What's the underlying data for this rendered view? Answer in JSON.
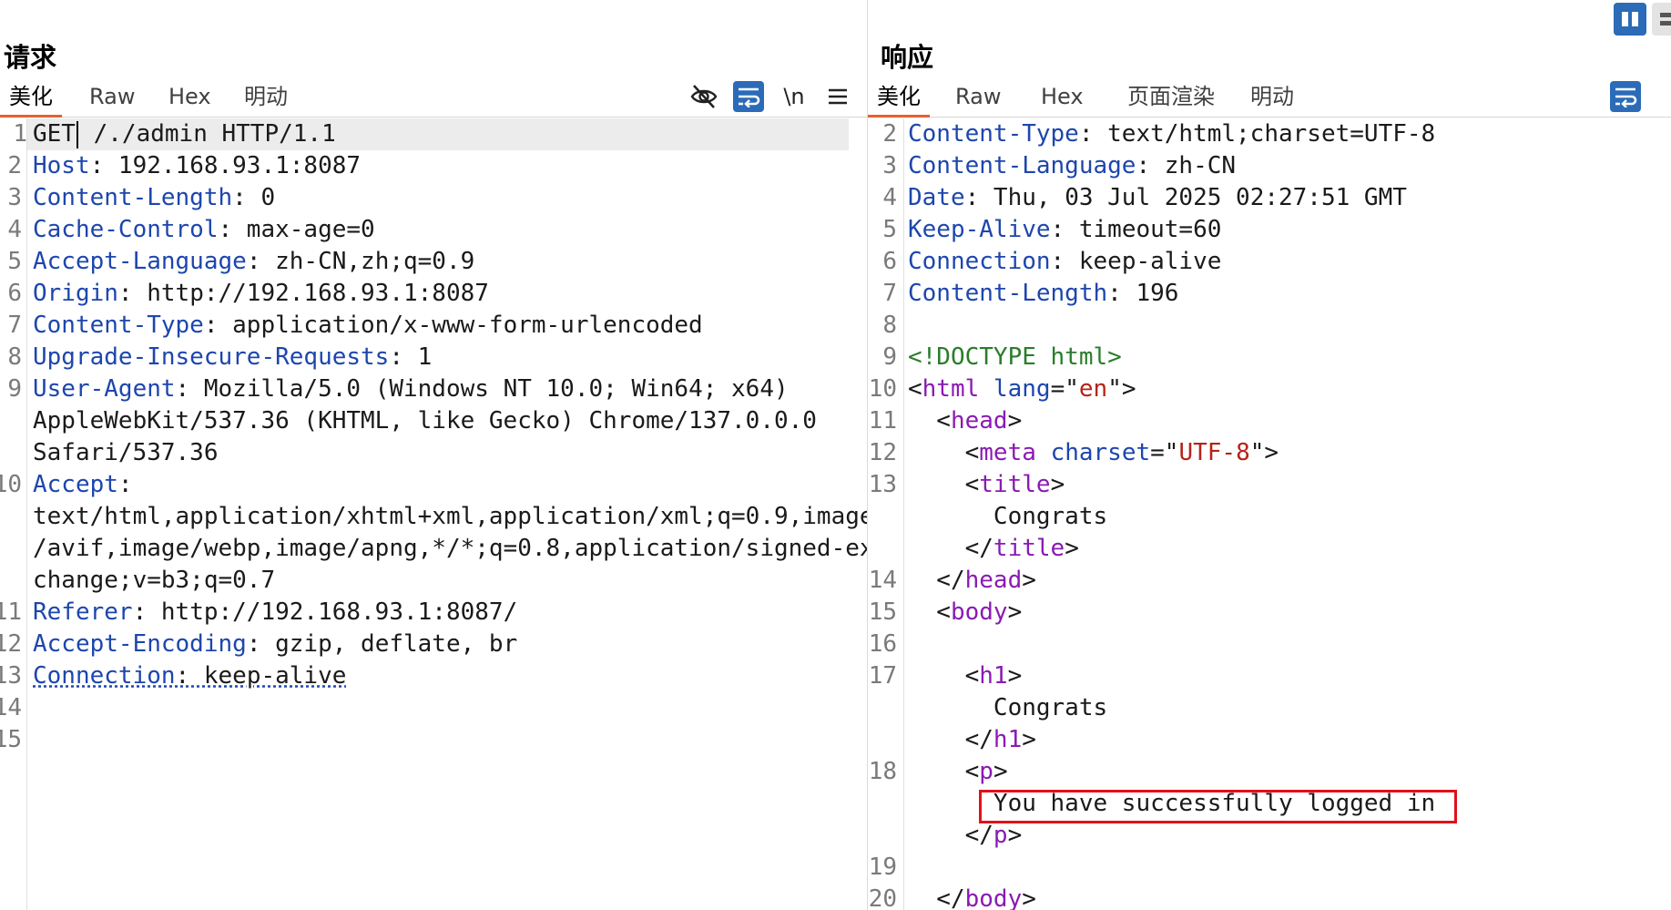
{
  "request": {
    "title": "请求",
    "tabs": [
      "美化",
      "Raw",
      "Hex",
      "明动"
    ],
    "active_tab": "美化",
    "toolbar_newline_label": "\\n",
    "lines": [
      {
        "n": "1",
        "key": "GET",
        "value": " /./admin HTTP/1.1"
      },
      {
        "n": "2",
        "key": "Host",
        "value": ": 192.168.93.1:8087"
      },
      {
        "n": "3",
        "key": "Content-Length",
        "value": ": 0"
      },
      {
        "n": "4",
        "key": "Cache-Control",
        "value": ": max-age=0"
      },
      {
        "n": "5",
        "key": "Accept-Language",
        "value": ": zh-CN,zh;q=0.9"
      },
      {
        "n": "6",
        "key": "Origin",
        "value": ": http://192.168.93.1:8087"
      },
      {
        "n": "7",
        "key": "Content-Type",
        "value": ": application/x-www-form-urlencoded"
      },
      {
        "n": "8",
        "key": "Upgrade-Insecure-Requests",
        "value": ": 1"
      },
      {
        "n": "9",
        "key": "User-Agent",
        "value": ": Mozilla/5.0 (Windows NT 10.0; Win64; x64)"
      },
      {
        "n": "",
        "key": "",
        "value": "AppleWebKit/537.36 (KHTML, like Gecko) Chrome/137.0.0.0"
      },
      {
        "n": "",
        "key": "",
        "value": "Safari/537.36"
      },
      {
        "n": "10",
        "key": "Accept",
        "value": ":"
      },
      {
        "n": "",
        "key": "",
        "value": "text/html,application/xhtml+xml,application/xml;q=0.9,image"
      },
      {
        "n": "",
        "key": "",
        "value": "/avif,image/webp,image/apng,*/*;q=0.8,application/signed-ex"
      },
      {
        "n": "",
        "key": "",
        "value": "change;v=b3;q=0.7"
      },
      {
        "n": "11",
        "key": "Referer",
        "value": ": http://192.168.93.1:8087/"
      },
      {
        "n": "12",
        "key": "Accept-Encoding",
        "value": ": gzip, deflate, br"
      },
      {
        "n": "13",
        "key": "Connection",
        "value": ": keep-alive"
      },
      {
        "n": "14",
        "key": "",
        "value": ""
      },
      {
        "n": "15",
        "key": "",
        "value": ""
      }
    ]
  },
  "response": {
    "title": "响应",
    "tabs": [
      "美化",
      "Raw",
      "Hex",
      "页面渲染",
      "明动"
    ],
    "active_tab": "美化",
    "highlighted_text": "You have successfully logged in",
    "lines": [
      {
        "n": "2",
        "parts": [
          [
            "hk",
            "Content-Type"
          ],
          [
            "hv",
            ": text/html;charset=UTF-8"
          ]
        ]
      },
      {
        "n": "3",
        "parts": [
          [
            "hk",
            "Content-Language"
          ],
          [
            "hv",
            ": zh-CN"
          ]
        ]
      },
      {
        "n": "4",
        "parts": [
          [
            "hk",
            "Date"
          ],
          [
            "hv",
            ": Thu, 03 Jul 2025 02:27:51 GMT"
          ]
        ]
      },
      {
        "n": "5",
        "parts": [
          [
            "hk",
            "Keep-Alive"
          ],
          [
            "hv",
            ": timeout=60"
          ]
        ]
      },
      {
        "n": "6",
        "parts": [
          [
            "hk",
            "Connection"
          ],
          [
            "hv",
            ": keep-alive"
          ]
        ]
      },
      {
        "n": "7",
        "parts": [
          [
            "hk",
            "Content-Length"
          ],
          [
            "hv",
            ": 196"
          ]
        ]
      },
      {
        "n": "8",
        "parts": []
      },
      {
        "n": "9",
        "parts": [
          [
            "dt",
            "<!DOCTYPE html>"
          ]
        ]
      },
      {
        "n": "10",
        "parts": [
          [
            "hv",
            "<"
          ],
          [
            "tg",
            "html"
          ],
          [
            "hv",
            " "
          ],
          [
            "at",
            "lang"
          ],
          [
            "hv",
            "=\""
          ],
          [
            "av",
            "en"
          ],
          [
            "hv",
            "\">"
          ]
        ]
      },
      {
        "n": "11",
        "parts": [
          [
            "hv",
            "  <"
          ],
          [
            "tg",
            "head"
          ],
          [
            "hv",
            ">"
          ]
        ]
      },
      {
        "n": "12",
        "parts": [
          [
            "hv",
            "    <"
          ],
          [
            "tg",
            "meta"
          ],
          [
            "hv",
            " "
          ],
          [
            "at",
            "charset"
          ],
          [
            "hv",
            "=\""
          ],
          [
            "av",
            "UTF-8"
          ],
          [
            "hv",
            "\">"
          ]
        ]
      },
      {
        "n": "13",
        "parts": [
          [
            "hv",
            "    <"
          ],
          [
            "tg",
            "title"
          ],
          [
            "hv",
            ">"
          ]
        ]
      },
      {
        "n": "",
        "parts": [
          [
            "hv",
            "      Congrats"
          ]
        ]
      },
      {
        "n": "",
        "parts": [
          [
            "hv",
            "    </"
          ],
          [
            "tg",
            "title"
          ],
          [
            "hv",
            ">"
          ]
        ]
      },
      {
        "n": "14",
        "parts": [
          [
            "hv",
            "  </"
          ],
          [
            "tg",
            "head"
          ],
          [
            "hv",
            ">"
          ]
        ]
      },
      {
        "n": "15",
        "parts": [
          [
            "hv",
            "  <"
          ],
          [
            "tg",
            "body"
          ],
          [
            "hv",
            ">"
          ]
        ]
      },
      {
        "n": "16",
        "parts": []
      },
      {
        "n": "17",
        "parts": [
          [
            "hv",
            "    <"
          ],
          [
            "tg",
            "h1"
          ],
          [
            "hv",
            ">"
          ]
        ]
      },
      {
        "n": "",
        "parts": [
          [
            "hv",
            "      Congrats"
          ]
        ]
      },
      {
        "n": "",
        "parts": [
          [
            "hv",
            "    </"
          ],
          [
            "tg",
            "h1"
          ],
          [
            "hv",
            ">"
          ]
        ]
      },
      {
        "n": "18",
        "parts": [
          [
            "hv",
            "    <"
          ],
          [
            "tg",
            "p"
          ],
          [
            "hv",
            ">"
          ]
        ]
      },
      {
        "n": "",
        "parts": [
          [
            "hv",
            "      You have successfully logged in"
          ]
        ]
      },
      {
        "n": "",
        "parts": [
          [
            "hv",
            "    </"
          ],
          [
            "tg",
            "p"
          ],
          [
            "hv",
            ">"
          ]
        ]
      },
      {
        "n": "19",
        "parts": []
      },
      {
        "n": "20",
        "parts": [
          [
            "hv",
            "  </"
          ],
          [
            "tg",
            "body"
          ],
          [
            "hv",
            ">"
          ]
        ]
      }
    ]
  },
  "colors": {
    "accent_tab_underline": "#e8602c",
    "header_key": "#1d46ad",
    "tag": "#8a1ab3",
    "attr_value": "#b5231a",
    "doctype": "#2a7d2a",
    "toolbar_button_blue": "#2b6bb8",
    "highlight_box": "#e1111a"
  },
  "icons": [
    "hide-eye-icon",
    "word-wrap-icon",
    "newline-icon",
    "menu-icon",
    "layout-split-icon",
    "layout-list-icon"
  ]
}
